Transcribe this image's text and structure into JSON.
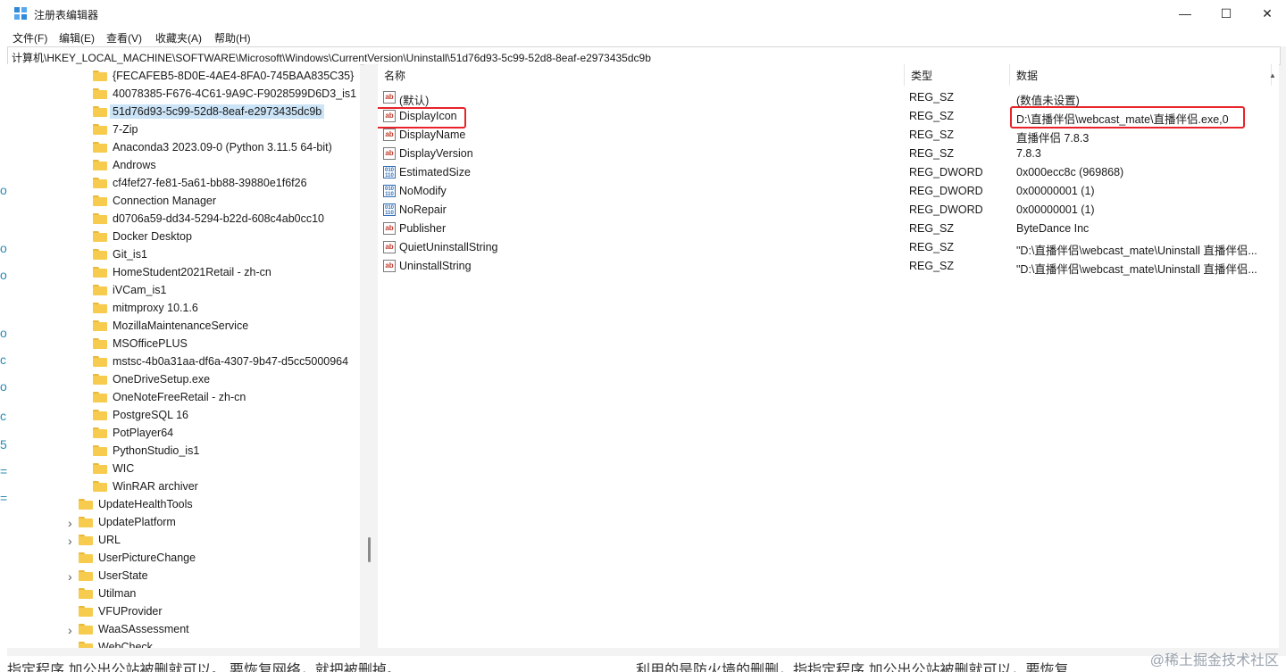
{
  "window": {
    "title": "注册表编辑器",
    "buttons": {
      "minimize": "—",
      "maximize": "☐",
      "close": "✕"
    }
  },
  "menu": [
    "文件(F)",
    "编辑(E)",
    "查看(V)",
    "收藏夹(A)",
    "帮助(H)"
  ],
  "address": "计算机\\HKEY_LOCAL_MACHINE\\SOFTWARE\\Microsoft\\Windows\\CurrentVersion\\Uninstall\\51d76d93-5c99-52d8-8eaf-e2973435dc9b",
  "tree": {
    "selected": "51d76d93-5c99-52d8-8eaf-e2973435dc9b",
    "children": [
      "{FECAFEB5-8D0E-4AE4-8FA0-745BAA835C35}",
      "40078385-F676-4C61-9A9C-F9028599D6D3_is1",
      "51d76d93-5c99-52d8-8eaf-e2973435dc9b",
      "7-Zip",
      "Anaconda3 2023.09-0 (Python 3.11.5 64-bit)",
      "Androws",
      "cf4fef27-fe81-5a61-bb88-39880e1f6f26",
      "Connection Manager",
      "d0706a59-dd34-5294-b22d-608c4ab0cc10",
      "Docker Desktop",
      "Git_is1",
      "HomeStudent2021Retail - zh-cn",
      "iVCam_is1",
      "mitmproxy 10.1.6",
      "MozillaMaintenanceService",
      "MSOfficePLUS",
      "mstsc-4b0a31aa-df6a-4307-9b47-d5cc5000964",
      "OneDriveSetup.exe",
      "OneNoteFreeRetail - zh-cn",
      "PostgreSQL 16",
      "PotPlayer64",
      "PythonStudio_is1",
      "WIC",
      "WinRAR archiver"
    ],
    "siblings": [
      {
        "label": "UpdateHealthTools",
        "expandable": false
      },
      {
        "label": "UpdatePlatform",
        "expandable": true
      },
      {
        "label": "URL",
        "expandable": true
      },
      {
        "label": "UserPictureChange",
        "expandable": false
      },
      {
        "label": "UserState",
        "expandable": true
      },
      {
        "label": "Utilman",
        "expandable": false
      },
      {
        "label": "VFUProvider",
        "expandable": false
      },
      {
        "label": "WaaSAssessment",
        "expandable": true
      },
      {
        "label": "WebCheck",
        "expandable": false
      }
    ]
  },
  "columns": {
    "name": "名称",
    "type": "类型",
    "data": "数据"
  },
  "values": [
    {
      "icon": "string-value-icon",
      "name": "(默认)",
      "type": "REG_SZ",
      "data": "(数值未设置)"
    },
    {
      "icon": "string-value-icon",
      "name": "DisplayIcon",
      "type": "REG_SZ",
      "data": "D:\\直播伴侣\\webcast_mate\\直播伴侣.exe,0"
    },
    {
      "icon": "string-value-icon",
      "name": "DisplayName",
      "type": "REG_SZ",
      "data": "直播伴侣 7.8.3"
    },
    {
      "icon": "string-value-icon",
      "name": "DisplayVersion",
      "type": "REG_SZ",
      "data": "7.8.3"
    },
    {
      "icon": "dword-value-icon",
      "name": "EstimatedSize",
      "type": "REG_DWORD",
      "data": "0x000ecc8c (969868)"
    },
    {
      "icon": "dword-value-icon",
      "name": "NoModify",
      "type": "REG_DWORD",
      "data": "0x00000001 (1)"
    },
    {
      "icon": "dword-value-icon",
      "name": "NoRepair",
      "type": "REG_DWORD",
      "data": "0x00000001 (1)"
    },
    {
      "icon": "string-value-icon",
      "name": "Publisher",
      "type": "REG_SZ",
      "data": "ByteDance Inc"
    },
    {
      "icon": "string-value-icon",
      "name": "QuietUninstallString",
      "type": "REG_SZ",
      "data": "\"D:\\直播伴侣\\webcast_mate\\Uninstall 直播伴侣..."
    },
    {
      "icon": "string-value-icon",
      "name": "UninstallString",
      "type": "REG_SZ",
      "data": "\"D:\\直播伴侣\\webcast_mate\\Uninstall 直播伴侣..."
    }
  ],
  "background": {
    "bottom_left": "指定程序 加公出公站被删就可以。 要恢复网络，就把被删掉。",
    "bottom_right": "利用的是防火墙的删删，指指定程序 加公出公站被删就可以，要恢复",
    "watermark": "@稀土掘金技术社区"
  },
  "colors": {
    "highlight": "#e8232a",
    "selection": "#cce4f7",
    "folder": "#f6cb4e"
  }
}
